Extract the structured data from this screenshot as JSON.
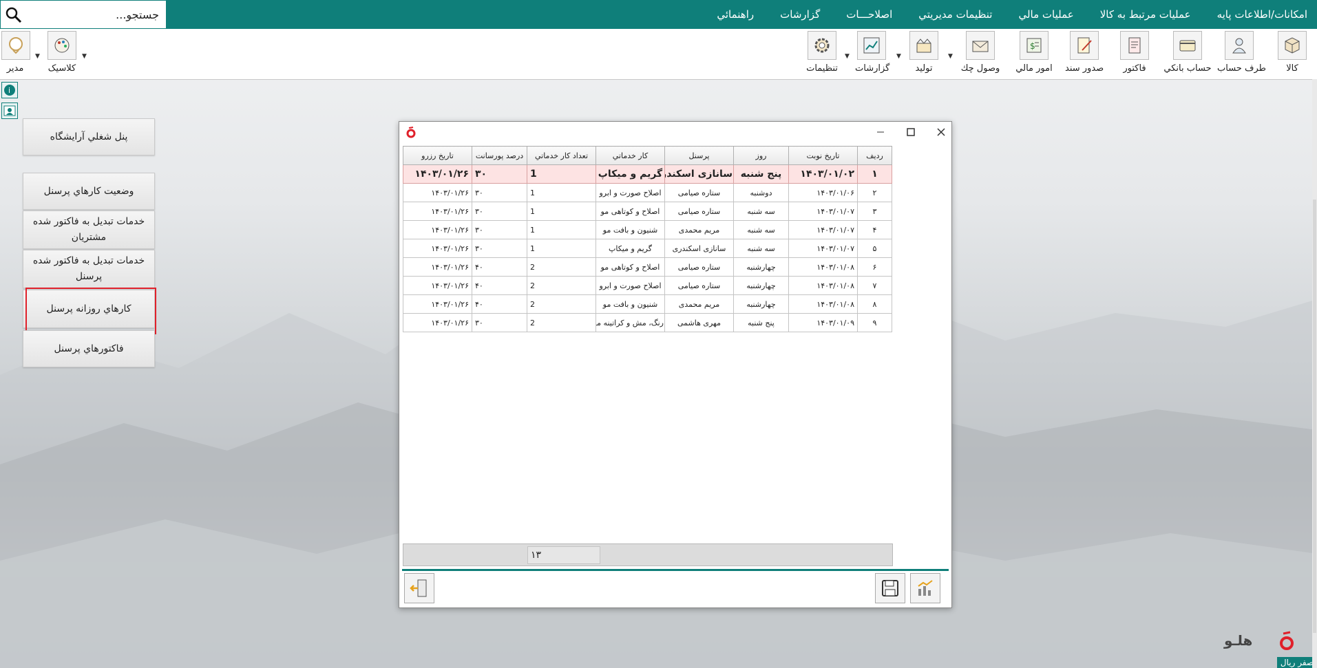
{
  "menu": {
    "items": [
      "امکانات/اطلاعات پايه",
      "عمليات مرتبط به کالا",
      "عمليات مالي",
      "تنظيمات مديريتي",
      "اصلاحـــات",
      "گزارشات",
      "راهنمائي"
    ],
    "search_placeholder": "جستجو..."
  },
  "toolbar": {
    "tools": [
      {
        "label": "کالا",
        "icon": "box-icon"
      },
      {
        "label": "طرف حساب",
        "icon": "person-icon"
      },
      {
        "label": "حساب بانکي",
        "icon": "bank-card-icon"
      },
      {
        "label": "فاکتور",
        "icon": "invoice-icon"
      },
      {
        "label": "صدور سند",
        "icon": "document-pen-icon"
      },
      {
        "label": "امور مالي",
        "icon": "finance-icon"
      },
      {
        "label": "وصول چك",
        "icon": "envelope-icon"
      },
      {
        "label": "توليد",
        "icon": "production-icon"
      },
      {
        "label": "گزارشات",
        "icon": "chart-report-icon"
      },
      {
        "label": "تنظيمات",
        "icon": "gear-icon"
      }
    ],
    "user_label": "مدير",
    "theme_label": "کلاسيک"
  },
  "sidebar": {
    "items": [
      "پنل شغلي آرايشگاه",
      "وضعيت کارهاي پرسنل",
      "خدمات تبديل به فاکتور شده مشتريان",
      "خدمات تبديل به فاکتور شده پرسنل",
      "کارهاي روزانه پرسنل",
      "فاکتورهاي پرسنل"
    ]
  },
  "dialog": {
    "columns": [
      "رديف",
      "تاريخ نوبت",
      "روز",
      "پرسنل",
      "کار خدماتي",
      "تعداد کار خدماتي",
      "درصد پورسانت",
      "تاريخ رزرو"
    ],
    "rows": [
      [
        "١",
        "١۴٠٣/٠١/٠٢",
        "پنج شنبه",
        "سانازی اسکندری",
        "گريم و ميکاپ",
        "1",
        "٣٠",
        "١۴٠٣/٠١/٢۶"
      ],
      [
        "٢",
        "١۴٠٣/٠١/٠۶",
        "دوشنبه",
        "ستاره صيامی",
        "اصلاح صورت و ابرو",
        "1",
        "٣٠",
        "١۴٠٣/٠١/٢۶"
      ],
      [
        "٣",
        "١۴٠٣/٠١/٠٧",
        "سه شنبه",
        "ستاره صيامی",
        "اصلاح و کوتاهی مو",
        "1",
        "٣٠",
        "١۴٠٣/٠١/٢۶"
      ],
      [
        "۴",
        "١۴٠٣/٠١/٠٧",
        "سه شنبه",
        "مريم محمدی",
        "شنيون و بافت مو",
        "1",
        "٣٠",
        "١۴٠٣/٠١/٢۶"
      ],
      [
        "۵",
        "١۴٠٣/٠١/٠٧",
        "سه شنبه",
        "سانازی اسکندری",
        "گريم و ميکاپ",
        "1",
        "٣٠",
        "١۴٠٣/٠١/٢۶"
      ],
      [
        "۶",
        "١۴٠٣/٠١/٠٨",
        "چهارشنبه",
        "ستاره صيامی",
        "اصلاح و کوتاهی مو",
        "2",
        "۴٠",
        "١۴٠٣/٠١/٢۶"
      ],
      [
        "٧",
        "١۴٠٣/٠١/٠٨",
        "چهارشنبه",
        "ستاره صيامی",
        "اصلاح صورت و ابرو",
        "2",
        "۴٠",
        "١۴٠٣/٠١/٢۶"
      ],
      [
        "٨",
        "١۴٠٣/٠١/٠٨",
        "چهارشنبه",
        "مريم محمدی",
        "شنيون و بافت مو",
        "2",
        "۴٠",
        "١۴٠٣/٠١/٢۶"
      ],
      [
        "٩",
        "١۴٠٣/٠١/٠٩",
        "پنج شنبه",
        "مهری هاشمی",
        "رنگ، مش و کراتينه مو",
        "2",
        "٣٠",
        "١۴٠٣/٠١/٢۶"
      ]
    ],
    "total": "١٣"
  },
  "brand": {
    "name": "هلـو",
    "currency": "صفر ريال"
  },
  "colors": {
    "accent": "#0f7f7a",
    "highlight_border": "#e0202a",
    "selected_row": "#fde3e3"
  }
}
